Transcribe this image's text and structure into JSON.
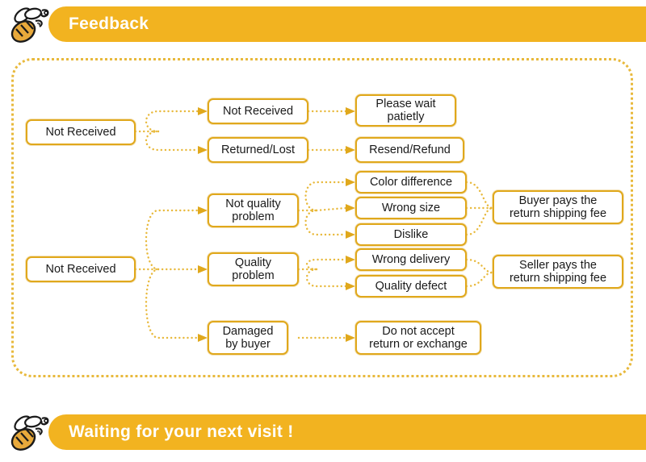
{
  "header": {
    "title": "Feedback",
    "icon": "bee-icon",
    "decoration": "",
    "bar_color": "#f2b320",
    "title_color": "#ffffff"
  },
  "footer": {
    "title": "Waiting for your next visit !",
    "icon": "bee-icon",
    "bar_color": "#f2b320",
    "title_color": "#ffffff"
  },
  "panel": {
    "border_color": "#e8b93c",
    "border_style": "dotted"
  },
  "flow": {
    "connector_color": "#e8b93c",
    "node_border_color": "#e0a81c",
    "nodes": [
      {
        "id": "not-received-1",
        "label": "Not Received"
      },
      {
        "id": "not-received-2",
        "label": "Not Received"
      },
      {
        "id": "returned-lost",
        "label": "Returned/Lost"
      },
      {
        "id": "please-wait",
        "label": "Please wait\npatietly"
      },
      {
        "id": "resend-refund",
        "label": "Resend/Refund"
      },
      {
        "id": "not-received-3",
        "label": "Not Received"
      },
      {
        "id": "not-quality-problem",
        "label": "Not quality\nproblem"
      },
      {
        "id": "quality-problem",
        "label": "Quality\nproblem"
      },
      {
        "id": "damaged-by-buyer",
        "label": "Damaged\nby buyer"
      },
      {
        "id": "color-difference",
        "label": "Color difference"
      },
      {
        "id": "wrong-size",
        "label": "Wrong size"
      },
      {
        "id": "dislike",
        "label": "Dislike"
      },
      {
        "id": "wrong-delivery",
        "label": "Wrong delivery"
      },
      {
        "id": "quality-defect",
        "label": "Quality defect"
      },
      {
        "id": "buyer-pays",
        "label": "Buyer pays the\nreturn shipping fee"
      },
      {
        "id": "seller-pays",
        "label": "Seller pays the\nreturn shipping fee"
      },
      {
        "id": "no-return-exchange",
        "label": "Do not accept\nreturn or exchange"
      }
    ]
  }
}
